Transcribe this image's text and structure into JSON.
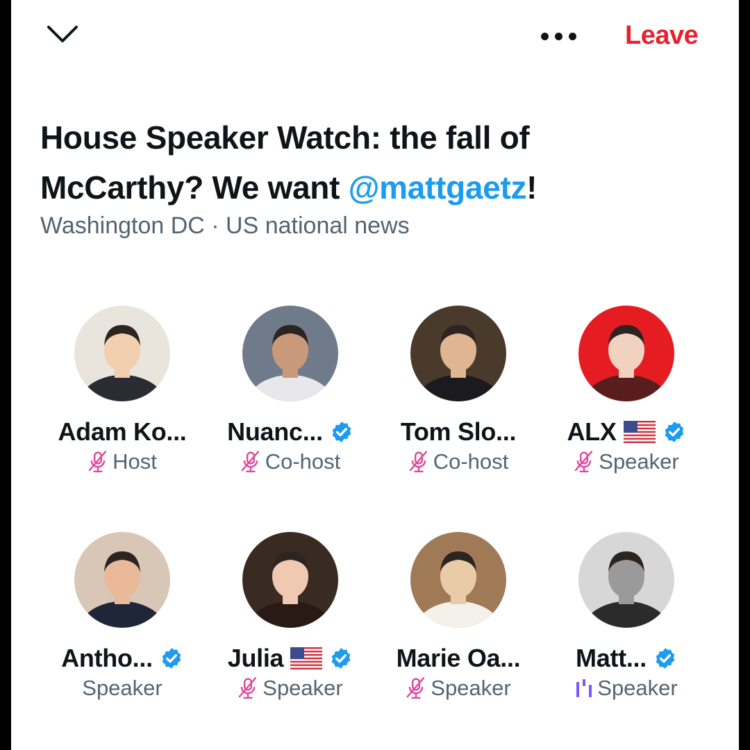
{
  "header": {
    "leave_label": "Leave"
  },
  "space": {
    "title_main": "House Speaker Watch: the fall of McCarthy? We want ",
    "title_mention": "@mattgaetz",
    "title_end": "!",
    "subtitle": "Washington DC · US national news"
  },
  "participants": [
    {
      "name": "Adam Ko...",
      "role": "Host",
      "verified": false,
      "flag": false,
      "mic": "muted"
    },
    {
      "name": "Nuanc...",
      "role": "Co-host",
      "verified": true,
      "flag": false,
      "mic": "muted"
    },
    {
      "name": "Tom Slo...",
      "role": "Co-host",
      "verified": false,
      "flag": false,
      "mic": "muted"
    },
    {
      "name": "ALX",
      "role": "Speaker",
      "verified": true,
      "flag": true,
      "mic": "muted"
    },
    {
      "name": "Antho...",
      "role": "Speaker",
      "verified": true,
      "flag": false,
      "mic": "none"
    },
    {
      "name": "Julia",
      "role": "Speaker",
      "verified": true,
      "flag": true,
      "mic": "muted"
    },
    {
      "name": "Marie Oa...",
      "role": "Speaker",
      "verified": false,
      "flag": false,
      "mic": "muted"
    },
    {
      "name": "Matt...",
      "role": "Speaker",
      "verified": true,
      "flag": false,
      "mic": "talking"
    }
  ],
  "colors": {
    "leave": "#e8202f",
    "mention": "#1d9bf0",
    "verified": "#1d9bf0",
    "muted_mic": "#e0489b",
    "talking": "#7856ff",
    "secondary_text": "#536471"
  }
}
